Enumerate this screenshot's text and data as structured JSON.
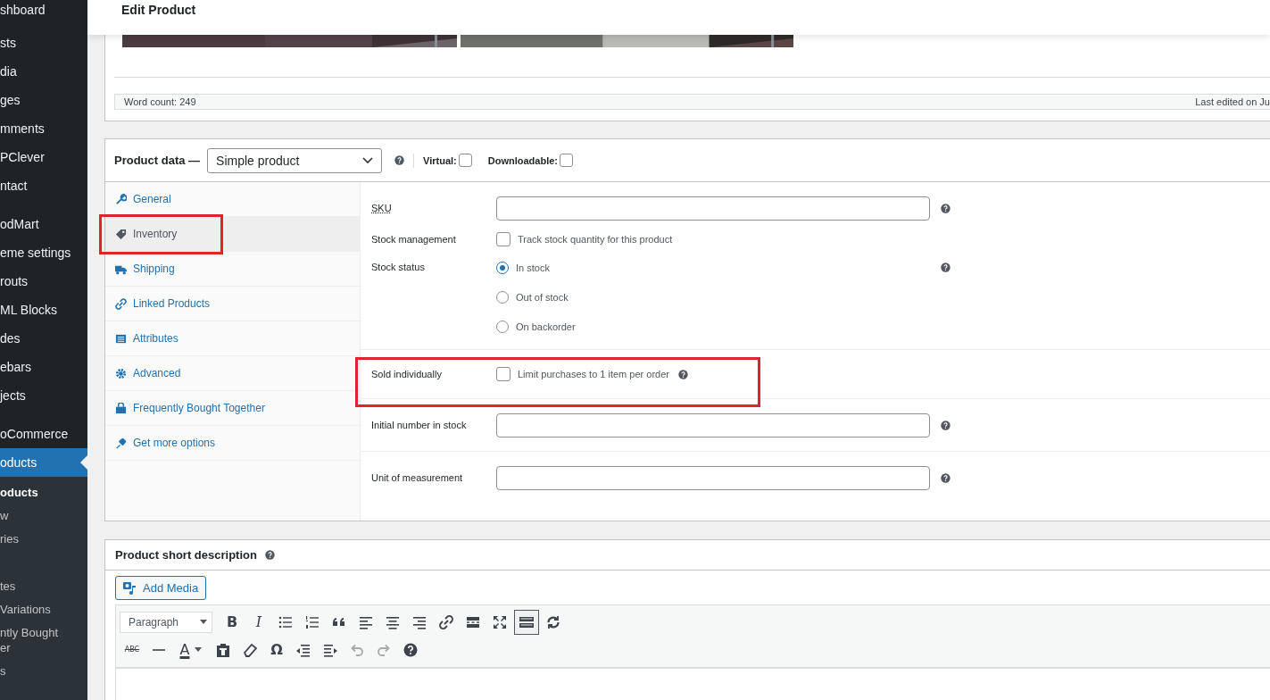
{
  "sidebar": {
    "groups": [
      {
        "items": [
          {
            "label": "shboard",
            "selected": false
          }
        ]
      },
      {
        "items": [
          {
            "label": "sts",
            "selected": false
          },
          {
            "label": "dia",
            "selected": false
          },
          {
            "label": "ges",
            "selected": false
          },
          {
            "label": "mments",
            "selected": false
          },
          {
            "label": "PClever",
            "selected": false
          },
          {
            "label": "ntact",
            "selected": false
          }
        ]
      },
      {
        "items": [
          {
            "label": "odMart",
            "selected": false
          },
          {
            "label": "eme settings",
            "selected": false
          },
          {
            "label": "routs",
            "selected": false
          },
          {
            "label": "ML Blocks",
            "selected": false
          },
          {
            "label": "des",
            "selected": false
          },
          {
            "label": "ebars",
            "selected": false
          },
          {
            "label": "jects",
            "selected": false
          }
        ]
      },
      {
        "items": [
          {
            "label": "oCommerce",
            "selected": false
          },
          {
            "label": "oducts",
            "selected": true
          }
        ]
      }
    ],
    "submenu": [
      {
        "label": "oducts",
        "selected": true
      },
      {
        "label": "w",
        "selected": false
      },
      {
        "label": "ries",
        "selected": false
      },
      {
        "label": "tes",
        "selected": false
      },
      {
        "label": "Variations",
        "selected": false
      },
      {
        "label": "ntly Bought\ner",
        "selected": false
      },
      {
        "label": "s",
        "selected": false
      }
    ]
  },
  "header": {
    "title": "Edit Product"
  },
  "editor": {
    "word_count": "Word count: 249",
    "last_edited": "Last edited on Ju"
  },
  "product_data": {
    "title": "Product data —",
    "type": "Simple product",
    "virtual": {
      "label": "Virtual:",
      "checked": false
    },
    "downloadable": {
      "label": "Downloadable:",
      "checked": false
    },
    "tabs": [
      {
        "label": "General",
        "selected": false,
        "highlighted": false
      },
      {
        "label": "Inventory",
        "selected": true,
        "highlighted": true
      },
      {
        "label": "Shipping",
        "selected": false,
        "highlighted": false
      },
      {
        "label": "Linked Products",
        "selected": false,
        "highlighted": false
      },
      {
        "label": "Attributes",
        "selected": false,
        "highlighted": false
      },
      {
        "label": "Advanced",
        "selected": false,
        "highlighted": false
      },
      {
        "label": "Frequently Bought Together",
        "selected": false,
        "highlighted": false
      },
      {
        "label": "Get more options",
        "selected": false,
        "highlighted": false
      }
    ],
    "groups": [
      {
        "rows": [
          {
            "kind": "text",
            "label": "SKU",
            "help": true,
            "highlighted": false
          },
          {
            "kind": "checkbox",
            "label": "Stock management",
            "text": "Track stock quantity for this product",
            "checked": false,
            "help": false,
            "highlighted": false
          },
          {
            "kind": "radio",
            "label": "Stock status",
            "help": true,
            "highlighted": false,
            "options": [
              {
                "label": "In stock",
                "selected": true
              },
              {
                "label": "Out of stock",
                "selected": false
              },
              {
                "label": "On backorder",
                "selected": false
              }
            ]
          }
        ]
      },
      {
        "rows": [
          {
            "kind": "checkbox",
            "label": "Sold individually",
            "text": "Limit purchases to 1 item per order",
            "checked": false,
            "help": true,
            "highlighted": true
          }
        ]
      },
      {
        "rows": [
          {
            "kind": "text",
            "label": "Initial number in stock",
            "help": true,
            "highlighted": false
          }
        ]
      },
      {
        "rows": [
          {
            "kind": "text",
            "label": "Unit of measurement",
            "help": true,
            "highlighted": false
          }
        ]
      }
    ]
  },
  "short_description": {
    "title": "Product short description",
    "add_media": "Add Media",
    "toolbar_rows": [
      [
        {
          "kind": "select",
          "text": "Paragraph"
        },
        {
          "kind": "glyph",
          "text": "B"
        },
        {
          "kind": "glyph",
          "text": "I"
        },
        {
          "kind": "icon"
        },
        {
          "kind": "icon"
        },
        {
          "kind": "icon"
        },
        {
          "kind": "icon"
        },
        {
          "kind": "icon"
        },
        {
          "kind": "icon"
        },
        {
          "kind": "icon"
        },
        {
          "kind": "icon"
        },
        {
          "kind": "icon"
        },
        {
          "kind": "icon",
          "pressed": true
        },
        {
          "kind": "icon"
        }
      ],
      [
        {
          "kind": "glyph",
          "text": "ABC"
        },
        {
          "kind": "icon"
        },
        {
          "kind": "glyph",
          "text": "A"
        },
        {
          "kind": "icon"
        },
        {
          "kind": "icon"
        },
        {
          "kind": "glyph",
          "text": "Ω"
        },
        {
          "kind": "icon"
        },
        {
          "kind": "icon"
        },
        {
          "kind": "icon",
          "disabled": true
        },
        {
          "kind": "icon",
          "disabled": true
        },
        {
          "kind": "icon"
        }
      ]
    ]
  }
}
